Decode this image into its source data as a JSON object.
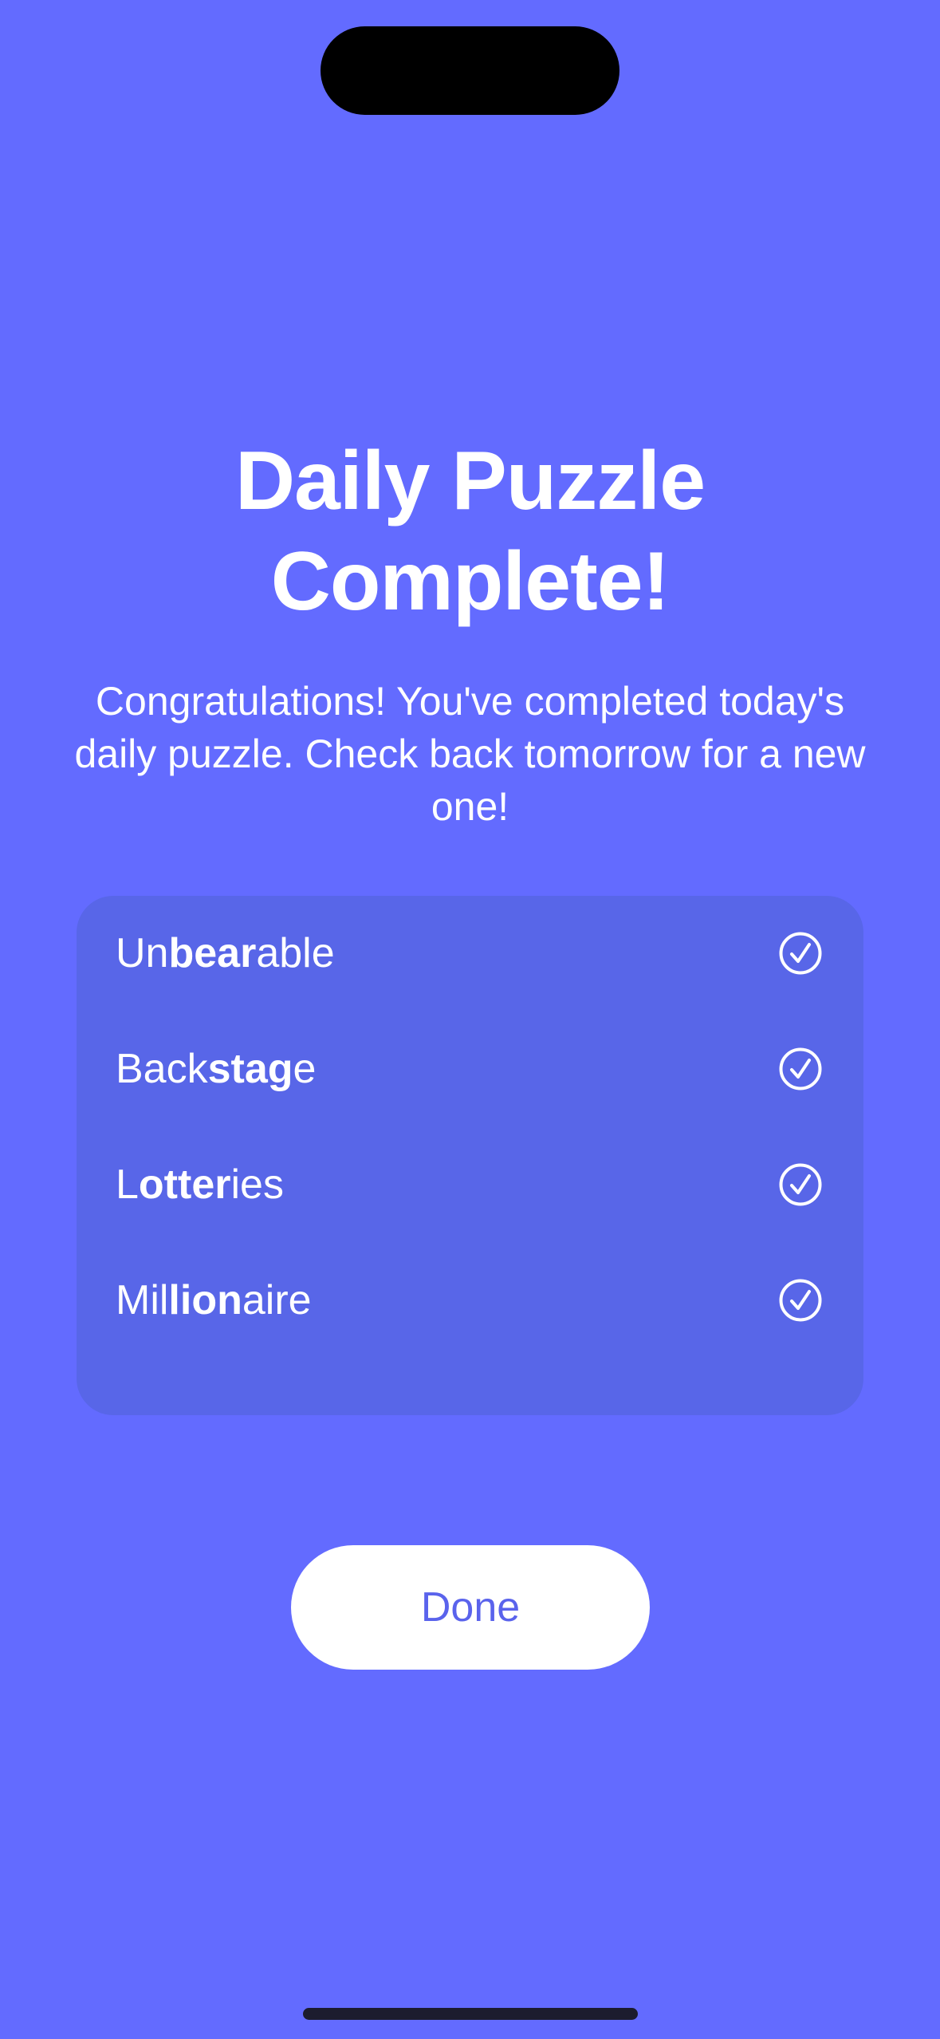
{
  "theme": {
    "background": "#636bff",
    "card_background": "#5866e8",
    "button_background": "#ffffff",
    "button_text": "#5a63ec",
    "text": "#ffffff"
  },
  "header": {
    "title_line1": "Daily Puzzle",
    "title_line2": "Complete!",
    "message": "Congratulations! You've completed today's daily puzzle. Check back tomorrow for a new one!"
  },
  "words": [
    {
      "before": "Un",
      "bold": "bear",
      "after": "able",
      "status_icon": "checkmark-circle-icon",
      "completed": true
    },
    {
      "before": "Back",
      "bold": "stag",
      "after": "e",
      "status_icon": "checkmark-circle-icon",
      "completed": true
    },
    {
      "before": "L",
      "bold": "otter",
      "after": "ies",
      "status_icon": "checkmark-circle-icon",
      "completed": true
    },
    {
      "before": "Mil",
      "bold": "lion",
      "after": "aire",
      "status_icon": "checkmark-circle-icon",
      "completed": true
    }
  ],
  "done_button": {
    "label": "Done"
  }
}
